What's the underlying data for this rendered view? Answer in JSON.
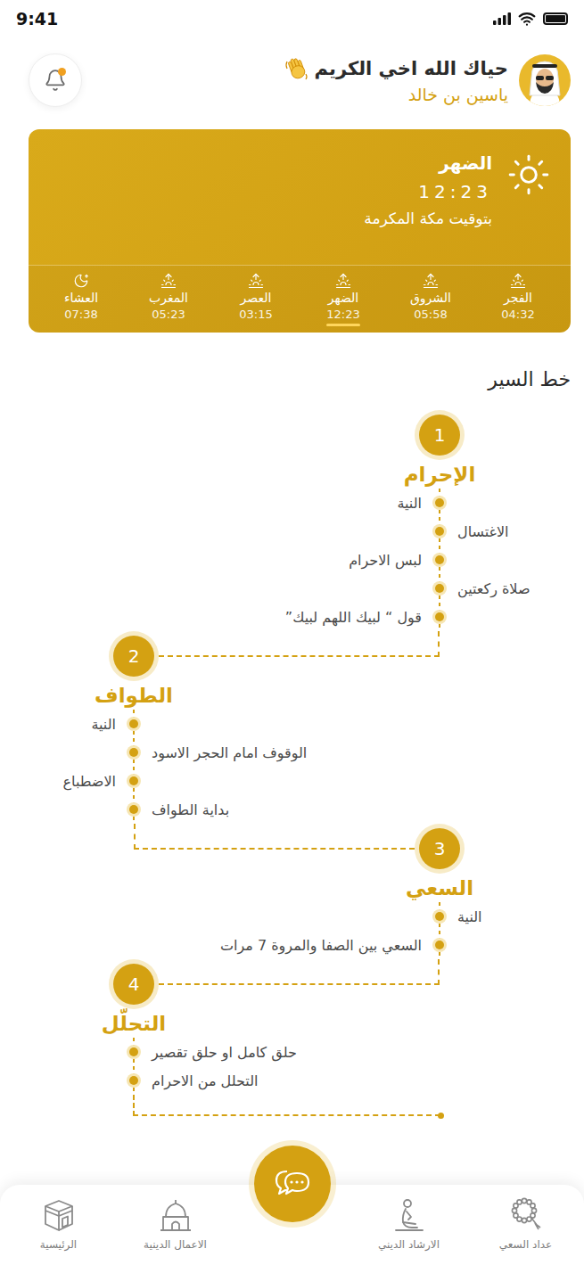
{
  "status_bar": {
    "time": "9:41",
    "battery": {
      "level": 1
    }
  },
  "header": {
    "greeting": "حياك الله اخي الكريم",
    "name": "ياسين بن خالد",
    "notification": true
  },
  "current_prayer": {
    "name": "الضهر",
    "time": "12:23",
    "note": "بتوقيت مكة المكرمة"
  },
  "prayers": [
    {
      "name": "الفجر",
      "time": "04:32",
      "kind": "day",
      "selected": false
    },
    {
      "name": "الشروق",
      "time": "05:58",
      "kind": "day",
      "selected": false
    },
    {
      "name": "الضهر",
      "time": "12:23",
      "kind": "day",
      "selected": true
    },
    {
      "name": "العصر",
      "time": "03:15",
      "kind": "day",
      "selected": false
    },
    {
      "name": "المغرب",
      "time": "05:23",
      "kind": "day",
      "selected": false
    },
    {
      "name": "العشاء",
      "time": "07:38",
      "kind": "night",
      "selected": false
    }
  ],
  "route": {
    "title": "خط السير",
    "stages": [
      {
        "number": "1",
        "title": "الإحرام",
        "steps": [
          {
            "text": "النية",
            "kind": "before"
          },
          {
            "text": "الاغتسال",
            "kind": "after"
          },
          {
            "text": "لبس الاحرام",
            "kind": "before"
          },
          {
            "text": "صلاة ركعتين",
            "kind": "after"
          },
          {
            "text": "قول “ لبيك اللهم لبيك”",
            "kind": "before"
          }
        ]
      },
      {
        "number": "2",
        "title": "الطواف",
        "steps": [
          {
            "text": "النية",
            "kind": "before"
          },
          {
            "text": "الوقوف امام الحجر الاسود",
            "kind": "after"
          },
          {
            "text": "الاضطباع",
            "kind": "before"
          },
          {
            "text": "بداية الطواف",
            "kind": "after"
          }
        ]
      },
      {
        "number": "3",
        "title": "السعي",
        "steps": [
          {
            "text": "النية",
            "kind": "after"
          },
          {
            "text": "السعي بين الصفا والمروة 7 مرات",
            "kind": "before"
          }
        ]
      },
      {
        "number": "4",
        "title": "التحلّل",
        "steps": [
          {
            "text": "حلق كامل او حلق تقصير",
            "kind": "after"
          },
          {
            "text": "التحلل من الاحرام",
            "kind": "after"
          }
        ]
      }
    ]
  },
  "nav": [
    {
      "label": "عداد السعي",
      "kind": "beads",
      "selected": false
    },
    {
      "label": "الارشاد الديني",
      "kind": "guide",
      "selected": false
    },
    {
      "label": "الاعمال الدينية",
      "kind": "mosque",
      "selected": false
    },
    {
      "label": "الرئيسية",
      "kind": "kaaba",
      "selected": false
    }
  ]
}
